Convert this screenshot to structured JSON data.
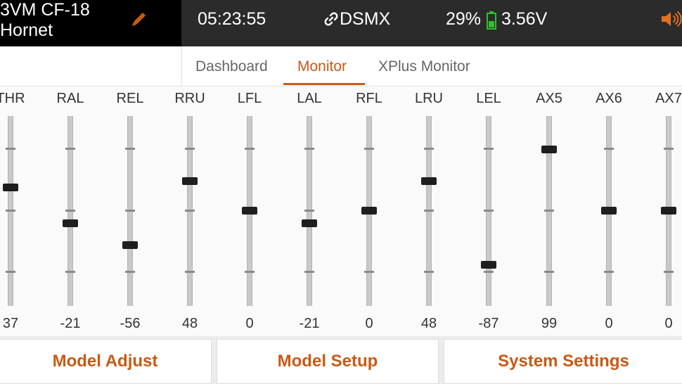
{
  "header": {
    "model_name": "3VM CF-18\nHornet",
    "time": "05:23:55",
    "protocol": "DSMX",
    "battery_percent": "29%",
    "voltage": "3.56V",
    "icons": {
      "edit": "pencil-icon",
      "link": "link-icon",
      "battery": "battery-icon",
      "speaker": "speaker-icon"
    },
    "colors": {
      "accent": "#c85a13",
      "battery_green": "#2fbf2f"
    }
  },
  "tabs": [
    {
      "label": "Dashboard",
      "active": false
    },
    {
      "label": "Monitor",
      "active": true
    },
    {
      "label": "XPlus Monitor",
      "active": false
    }
  ],
  "channels": [
    {
      "label": "THR",
      "value": "37",
      "num": 37
    },
    {
      "label": "RAL",
      "value": "-21",
      "num": -21
    },
    {
      "label": "REL",
      "value": "-56",
      "num": -56
    },
    {
      "label": "RRU",
      "value": "48",
      "num": 48
    },
    {
      "label": "LFL",
      "value": "0",
      "num": 0
    },
    {
      "label": "LAL",
      "value": "-21",
      "num": -21
    },
    {
      "label": "RFL",
      "value": "0",
      "num": 0
    },
    {
      "label": "LRU",
      "value": "48",
      "num": 48
    },
    {
      "label": "LEL",
      "value": "-87",
      "num": -87
    },
    {
      "label": "AX5",
      "value": "99",
      "num": 99
    },
    {
      "label": "AX6",
      "value": "0",
      "num": 0
    },
    {
      "label": "AX7",
      "value": "0",
      "num": 0
    }
  ],
  "buttons": {
    "model_adjust": "Model Adjust",
    "model_setup": "Model Setup",
    "system_settings": "System Settings"
  }
}
